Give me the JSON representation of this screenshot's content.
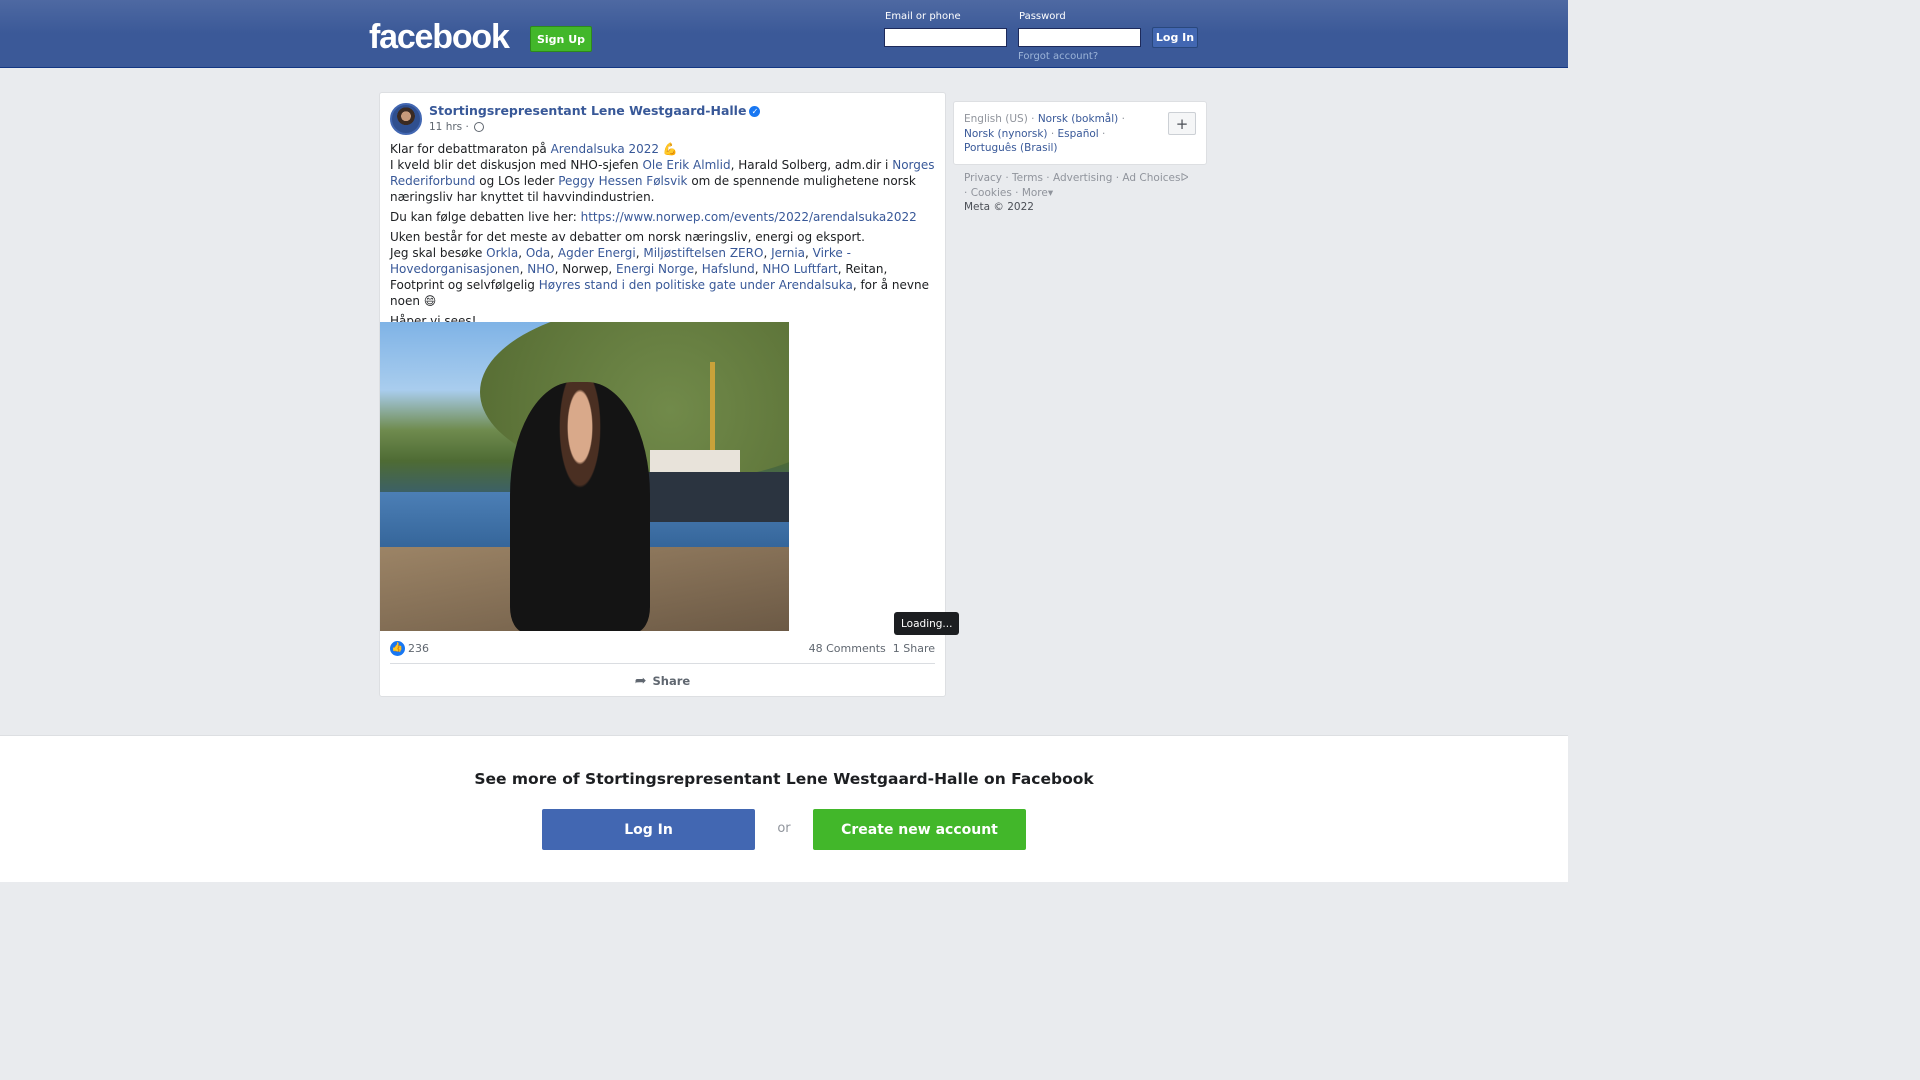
{
  "header": {
    "logo": "facebook",
    "signup_label": "Sign Up",
    "email_label": "Email or phone",
    "password_label": "Password",
    "login_label": "Log In",
    "forgot_label": "Forgot account?",
    "bg_color": "#3b5998"
  },
  "post": {
    "author": "Stortingsrepresentant Lene Westgaard-Halle",
    "verified": true,
    "time": "11 hrs",
    "audience_icon": "globe-icon",
    "paragraph1": {
      "t1": "Klar for debattmaraton på ",
      "l1": "Arendalsuka 2022",
      "t2": " 💪",
      "t3": "I kveld blir det diskusjon med NHO-sjefen ",
      "l2": "Ole Erik Almlid",
      "t4": ", Harald Solberg, adm.dir i ",
      "l3": "Norges Rederiforbund",
      "t5": " og LOs leder ",
      "l4": "Peggy Hessen Følsvik",
      "t6": " om de spennende mulighetene norsk næringsliv har knyttet til havvindindustrien."
    },
    "paragraph2": {
      "t1": "Du kan følge debatten live her: ",
      "l1": "https://www.norwep.com/events/2022/arendalsuka2022"
    },
    "paragraph3": {
      "t1": "Uken består for det meste av debatter om norsk næringsliv, energi og eksport.",
      "t2": "Jeg skal besøke ",
      "l1": "Orkla",
      "s1": ", ",
      "l2": "Oda",
      "s2": ", ",
      "l3": "Agder Energi",
      "s3": ", ",
      "l4": "Miljøstiftelsen ZERO",
      "s4": ", ",
      "l5": "Jernia",
      "s5": ", ",
      "l6": "Virke - Hovedorganisasjonen",
      "s6": ", ",
      "l7": "NHO",
      "s7": ", Norwep, ",
      "l8": "Energi Norge",
      "s8": ", ",
      "l9": "Hafslund",
      "s9": ", ",
      "l10": "NHO Luftfart",
      "s10": ", Reitan, Footprint og selvfølgelig ",
      "l11": "Høyres stand i den politiske gate under Arendalsuka",
      "s11": ", for å nevne noen 😄"
    },
    "paragraph4": "Håper vi sees!",
    "tooltip": "Loading...",
    "reactions": "236",
    "comments": "48 Comments",
    "shares": "1 Share",
    "share_label": "Share"
  },
  "sidebar": {
    "lang_current": "English (US)",
    "lang1": "Norsk (bokmål)",
    "lang2": "Norsk (nynorsk)",
    "lang3": "Español",
    "lang4": "Português (Brasil)",
    "plus": "+",
    "links": [
      "Privacy",
      "Terms",
      "Advertising",
      "Ad Choices",
      "Cookies",
      "More"
    ],
    "copyright": "Meta © 2022"
  },
  "banner": {
    "title": "See more of Stortingsrepresentant Lene Westgaard-Halle on Facebook",
    "login_label": "Log In",
    "or_label": "or",
    "create_label": "Create new account"
  },
  "colors": {
    "link": "#385898",
    "green": "#42b72a",
    "blue_button": "#4267b2"
  }
}
